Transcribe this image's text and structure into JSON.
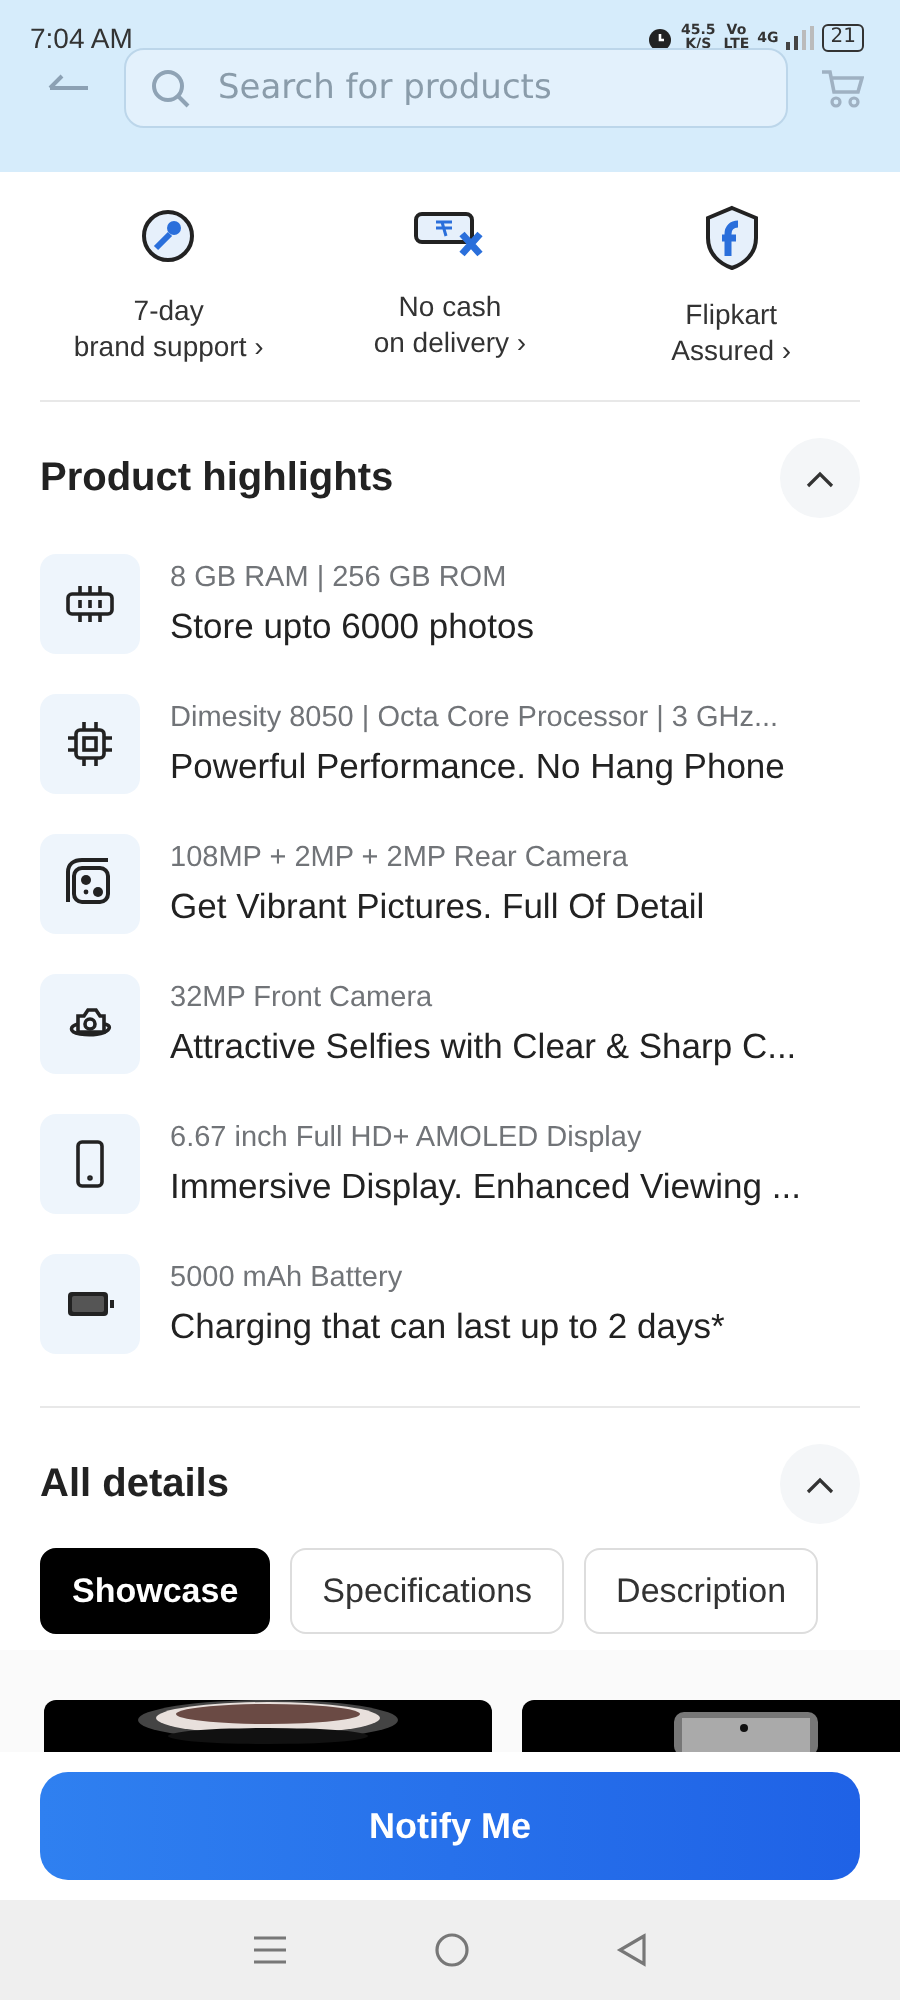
{
  "status_bar": {
    "time": "7:04 AM",
    "speed": "45.5",
    "speed_unit": "K/S",
    "volte_top": "Vo",
    "volte_bottom": "LTE",
    "network": "4G",
    "battery": "21"
  },
  "search": {
    "placeholder": "Search for products"
  },
  "assurances": [
    {
      "kind": "support",
      "line1": "7-day",
      "line2": "brand support ›"
    },
    {
      "kind": "nocash",
      "line1": "No cash",
      "line2": "on delivery ›"
    },
    {
      "kind": "assured",
      "line1": "Flipkart",
      "line2": "Assured ›"
    }
  ],
  "highlights": {
    "title": "Product highlights",
    "expanded": true,
    "items": [
      {
        "kind": "memory",
        "spec": "8 GB RAM | 256 GB ROM",
        "benefit": "Store upto 6000 photos"
      },
      {
        "kind": "chip",
        "spec": "Dimesity 8050 | Octa Core Processor | 3 GHz...",
        "benefit": "Powerful Performance. No Hang Phone"
      },
      {
        "kind": "rear",
        "spec": "108MP + 2MP + 2MP Rear Camera",
        "benefit": "Get Vibrant Pictures. Full Of Detail"
      },
      {
        "kind": "front",
        "spec": "32MP Front Camera",
        "benefit": "Attractive Selfies with Clear & Sharp C..."
      },
      {
        "kind": "display",
        "spec": "6.67 inch Full HD+ AMOLED Display",
        "benefit": "Immersive Display. Enhanced Viewing ..."
      },
      {
        "kind": "battery",
        "spec": "5000 mAh Battery",
        "benefit": "Charging that can last up to 2 days*"
      }
    ]
  },
  "details": {
    "title": "All details",
    "expanded": true,
    "tabs": [
      {
        "label": "Showcase",
        "selected": true
      },
      {
        "label": "Specifications",
        "selected": false
      },
      {
        "label": "Description",
        "selected": false
      }
    ]
  },
  "notify_button": "Notify Me"
}
